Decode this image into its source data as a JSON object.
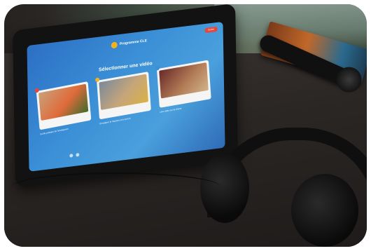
{
  "app": {
    "logo_text": "Programme CLE",
    "top_button": "Quitter"
  },
  "screen": {
    "heading": "Sélectionner une vidéo",
    "videos": [
      {
        "caption": "Guide pratique de l'enseignant",
        "dot_color": "#e8463c",
        "thumb_colors": [
          "#c9a07a",
          "#e06b3a",
          "#3f6b2e"
        ]
      },
      {
        "caption": "Enseigner le français et la lecture",
        "dot_color": "#f3b21b",
        "thumb_colors": [
          "#7a8a9a",
          "#c6a57a",
          "#d9b243"
        ]
      },
      {
        "caption": "Une vidéo sur la classe",
        "dot_color": "#3a8fd6",
        "thumb_colors": [
          "#6a2a2a",
          "#b07a55",
          "#d2b38a"
        ]
      }
    ]
  },
  "colors": {
    "screen_blue": "#3a8fd6",
    "accent_red": "#e8463c",
    "accent_yellow": "#f3b21b"
  }
}
